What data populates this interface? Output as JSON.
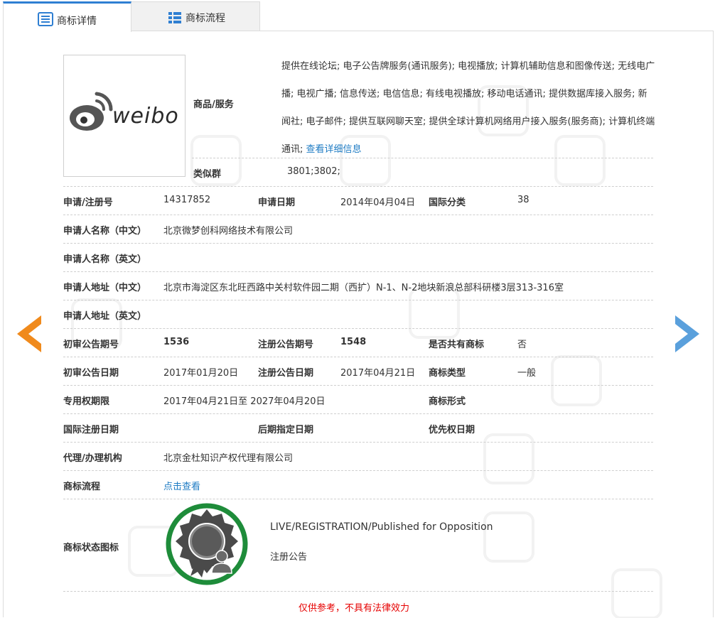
{
  "tabs": [
    {
      "label": "商标详情",
      "icon": "list-icon",
      "active": true
    },
    {
      "label": "商标流程",
      "icon": "grid-list-icon",
      "active": false
    }
  ],
  "logo": {
    "text": "weibo"
  },
  "goods": {
    "label": "商品/服务",
    "text": "提供在线论坛; 电子公告牌服务(通讯服务); 电视播放; 计算机辅助信息和图像传送; 无线电广播; 电视广播; 信息传送; 电信信息; 有线电视播放; 移动电话通讯; 提供数据库接入服务; 新闻社; 电子邮件; 提供互联网聊天室; 提供全球计算机网络用户接入服务(服务商); 计算机终端通讯;",
    "link": "查看详细信息"
  },
  "similar_group": {
    "label": "类似群",
    "value": "3801;3802;"
  },
  "fields": {
    "reg_no_label": "申请/注册号",
    "reg_no": "14317852",
    "apply_date_label": "申请日期",
    "apply_date": "2014年04月04日",
    "intl_class_label": "国际分类",
    "intl_class": "38",
    "applicant_cn_label": "申请人名称（中文）",
    "applicant_cn": "北京微梦创科网络技术有限公司",
    "applicant_en_label": "申请人名称（英文）",
    "applicant_en": "",
    "address_cn_label": "申请人地址（中文）",
    "address_cn": "北京市海淀区东北旺西路中关村软件园二期（西扩）N-1、N-2地块新浪总部科研楼3层313-316室",
    "address_en_label": "申请人地址（英文）",
    "address_en": "",
    "prelim_no_label": "初审公告期号",
    "prelim_no": "1536",
    "reg_pub_no_label": "注册公告期号",
    "reg_pub_no": "1548",
    "shared_label": "是否共有商标",
    "shared": "否",
    "prelim_date_label": "初审公告日期",
    "prelim_date": "2017年01月20日",
    "reg_pub_date_label": "注册公告日期",
    "reg_pub_date": "2017年04月21日",
    "tm_type_label": "商标类型",
    "tm_type": "一般",
    "exclusive_label": "专用权期限",
    "exclusive": "2017年04月21日至 2027年04月20日",
    "tm_form_label": "商标形式",
    "tm_form": "",
    "intl_reg_date_label": "国际注册日期",
    "intl_reg_date": "",
    "later_date_label": "后期指定日期",
    "later_date": "",
    "priority_label": "优先权日期",
    "priority": "",
    "agent_label": "代理/办理机构",
    "agent": "北京金杜知识产权代理有限公司",
    "flow_label": "商标流程",
    "flow_link": "点击查看",
    "status_icon_label": "商标状态图标"
  },
  "status": {
    "en": "LIVE/REGISTRATION/Published for Opposition",
    "cn": "注册公告",
    "ring_color": "#1e8c3a",
    "badge_color": "#4a4a4a"
  },
  "note": "仅供参考，不具有法律效力",
  "colors": {
    "accent": "#2f7fd2",
    "link": "#1f7cc4",
    "left_arrow": "#f08a1c",
    "right_arrow": "#5aa0dc",
    "note": "#e60000"
  }
}
